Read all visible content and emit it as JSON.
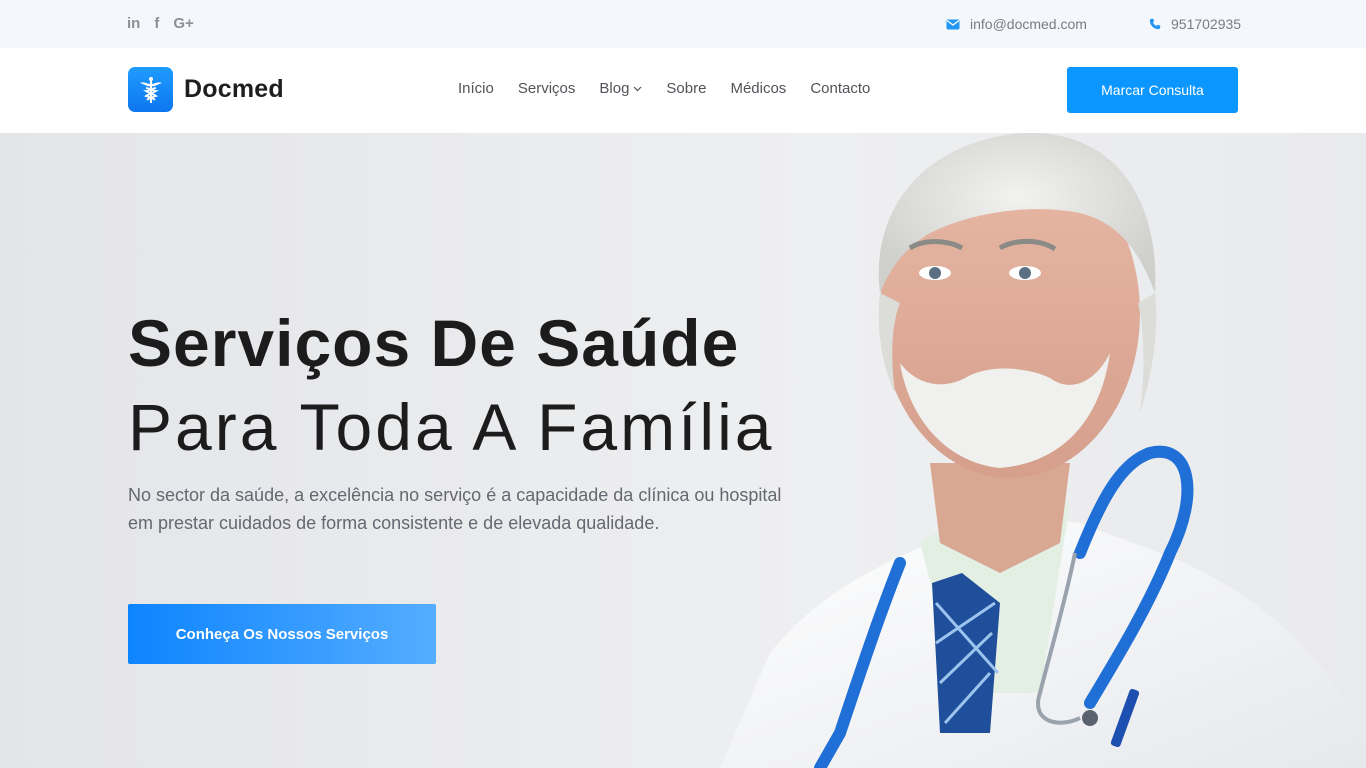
{
  "topbar": {
    "social": [
      {
        "icon": "linkedin-icon",
        "glyph": "in"
      },
      {
        "icon": "facebook-icon",
        "glyph": "f"
      },
      {
        "icon": "google-plus-icon",
        "glyph": "G+"
      }
    ],
    "email": "info@docmed.com",
    "phone": "951702935"
  },
  "header": {
    "logo_text": "Docmed",
    "nav": [
      {
        "label": "Início"
      },
      {
        "label": "Serviços"
      },
      {
        "label": "Blog",
        "has_dropdown": true
      },
      {
        "label": "Sobre"
      },
      {
        "label": "Médicos"
      },
      {
        "label": "Contacto"
      }
    ],
    "cta_label": "Marcar Consulta"
  },
  "hero": {
    "title_line1": "Serviços De Saúde",
    "title_line2": "Para Toda A Família",
    "description": "No sector da saúde, a excelência no serviço é a capacidade da clínica ou hospital em prestar cuidados de forma consistente e de elevada qualidade.",
    "button_label": "Conheça Os Nossos Serviços"
  },
  "colors": {
    "accent": "#0b97ff",
    "topbar_bg": "#f4f8fc",
    "hero_bg": "#e9eaed"
  }
}
